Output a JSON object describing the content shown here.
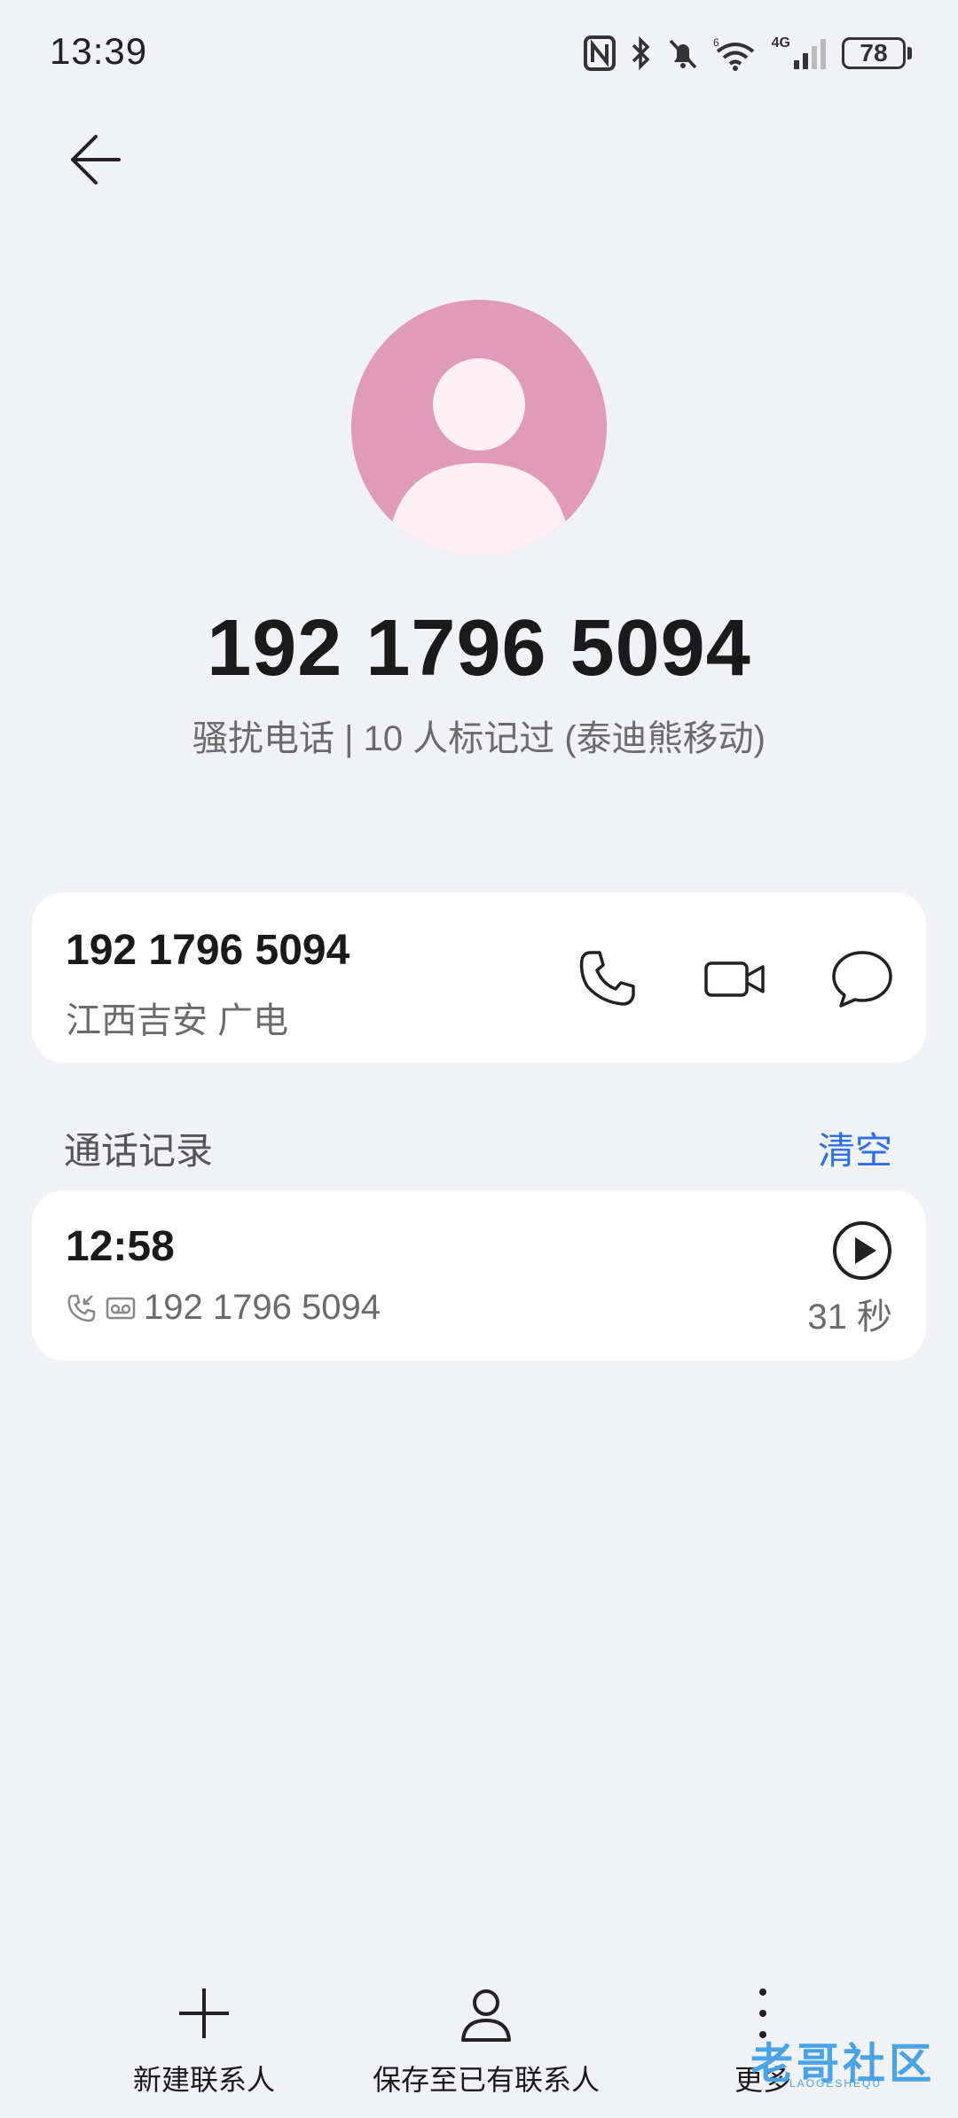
{
  "status_bar": {
    "time": "13:39",
    "network": "4G",
    "battery": "78",
    "icons": [
      "nfc-icon",
      "bluetooth-icon",
      "mute-icon",
      "wifi-icon",
      "signal-icon",
      "battery-icon"
    ]
  },
  "header": {
    "back_icon": "arrow-left-icon"
  },
  "profile": {
    "avatar_color": "#e09aba",
    "number": "192 1796 5094",
    "tag_line": "骚扰电话 | 10 人标记过 (泰迪熊移动)"
  },
  "contact_card": {
    "number": "192 1796 5094",
    "location": "江西吉安 广电",
    "actions": [
      "phone-icon",
      "video-call-icon",
      "message-icon"
    ]
  },
  "call_log": {
    "title": "通话记录",
    "clear_label": "清空",
    "accent_color": "#2c6ee8",
    "entries": [
      {
        "time": "12:58",
        "number": "192 1796 5094",
        "duration": "31 秒"
      }
    ]
  },
  "bottom_bar": {
    "new_contact": "新建联系人",
    "save_existing": "保存至已有联系人",
    "more": "更多"
  },
  "watermark": {
    "text": "老哥社区",
    "sub": "LAOGESHEQU"
  }
}
